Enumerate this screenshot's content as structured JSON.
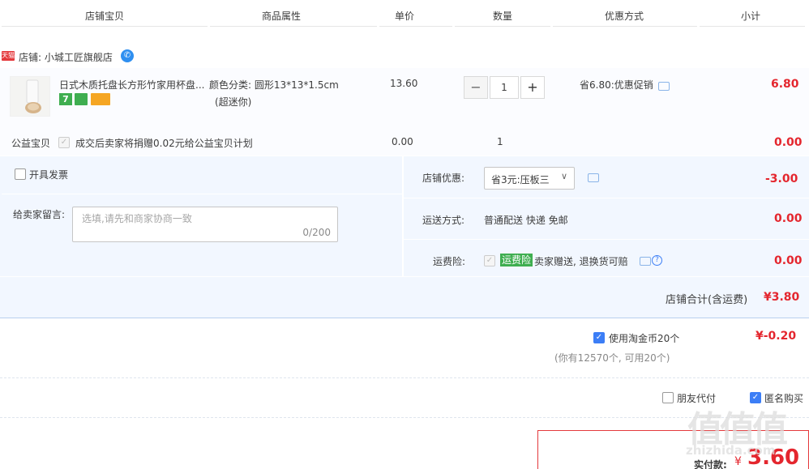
{
  "header": {
    "col_item": "店铺宝贝",
    "col_attr": "商品属性",
    "col_price": "单价",
    "col_qty": "数量",
    "col_promo": "优惠方式",
    "col_subtotal": "小计"
  },
  "shop": {
    "badge": "天猫",
    "label": "店铺: 小城工匠旗舰店"
  },
  "item": {
    "title": "日式木质托盘长方形竹家用杯盘...",
    "attr_line1": "颜色分类: 圆形13*13*1.5cm",
    "attr_line2": "(超迷你)",
    "price": "13.60",
    "qty": "1",
    "minus": "−",
    "plus": "+",
    "promo": "省6.80:优惠促销",
    "subtotal": "6.80",
    "badge_seven": "7"
  },
  "charity": {
    "label": "公益宝贝",
    "text": "成交后卖家将捐赠0.02元给公益宝贝计划",
    "price": "0.00",
    "qty": "1",
    "subtotal": "0.00"
  },
  "invoice": {
    "label": "开具发票"
  },
  "message": {
    "label": "给卖家留言:",
    "placeholder": "选填,请先和商家协商一致",
    "counter": "0/200"
  },
  "shop_discount": {
    "label": "店铺优惠:",
    "selected": "省3元:压板三",
    "amount": "-3.00"
  },
  "shipping": {
    "label": "运送方式:",
    "value": "普通配送 快递 免邮",
    "amount": "0.00"
  },
  "insurance": {
    "label": "运费险:",
    "badge": "运费险",
    "text": "卖家赠送, 退换货可赔",
    "amount": "0.00"
  },
  "shop_total": {
    "label": "店铺合计(含运费)",
    "amount": "¥3.80"
  },
  "coins": {
    "label": "使用淘金币20个",
    "note": "(你有12570个, 可用20个)",
    "amount": "¥-0.20"
  },
  "options": {
    "friend_pay": "朋友代付",
    "anonymous": "匿名购买"
  },
  "pay": {
    "label": "实付款:",
    "currency": "¥",
    "amount": "3.60"
  },
  "watermark": {
    "glyphs": "值值值",
    "url": "zhizhida.com"
  },
  "colors": {
    "accent_red": "#e4262e",
    "checkbox_blue": "#3c7ef6",
    "order_bg": "#f2f7ff",
    "insurance_green": "#3fae50"
  }
}
